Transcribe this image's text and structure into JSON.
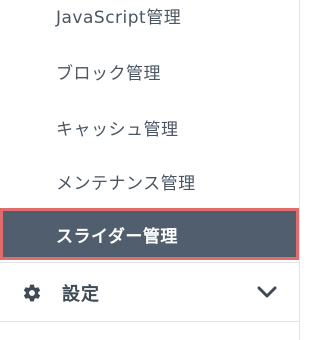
{
  "sidebar": {
    "submenu_items": [
      {
        "label": "JavaScript管理",
        "active": false
      },
      {
        "label": "ブロック管理",
        "active": false
      },
      {
        "label": "キャッシュ管理",
        "active": false
      },
      {
        "label": "メンテナンス管理",
        "active": false
      },
      {
        "label": "スライダー管理",
        "active": true
      }
    ],
    "settings_section": {
      "label": "設定",
      "icon": "gear-icon",
      "expand_icon": "chevron-down-icon"
    }
  },
  "colors": {
    "active_bg": "#515e6e",
    "active_border": "#e06c6c",
    "text": "#4a5662",
    "divider": "#e3e3e3"
  }
}
